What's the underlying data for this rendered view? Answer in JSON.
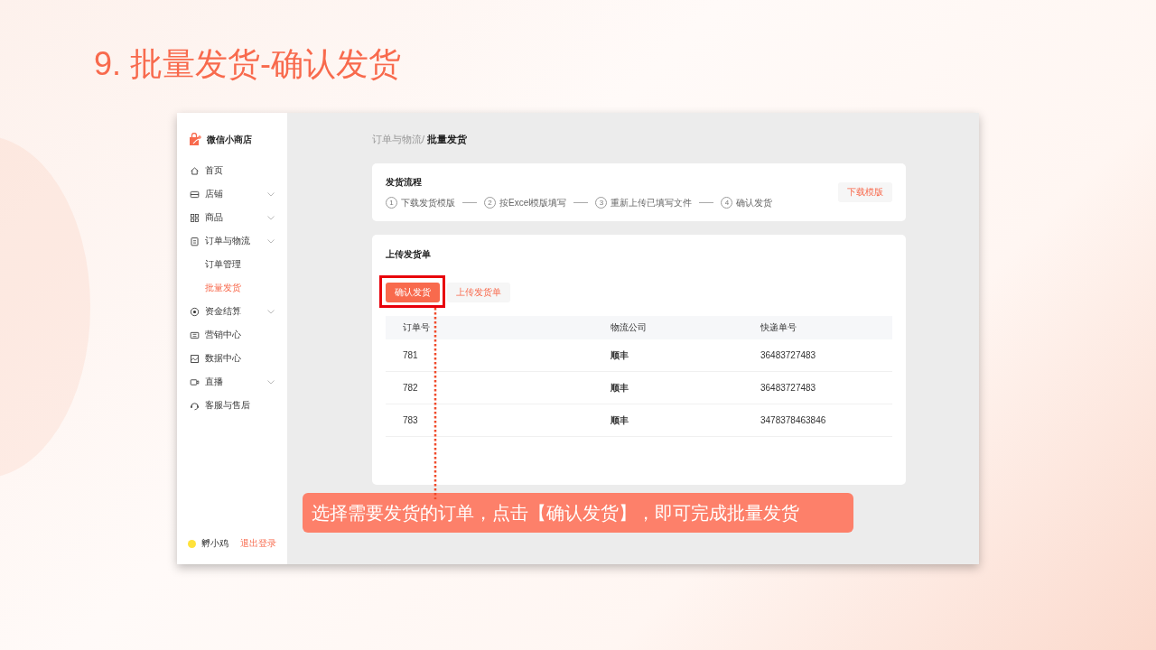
{
  "slide_title": "9. 批量发货-确认发货",
  "app": {
    "brand": "微信小商店",
    "sidebar": {
      "items": [
        {
          "label": "首页",
          "expandable": false
        },
        {
          "label": "店铺",
          "expandable": true
        },
        {
          "label": "商品",
          "expandable": true
        },
        {
          "label": "订单与物流",
          "expandable": true,
          "children": [
            {
              "label": "订单管理",
              "selected": false
            },
            {
              "label": "批量发货",
              "selected": true
            }
          ]
        },
        {
          "label": "资金结算",
          "expandable": true
        },
        {
          "label": "营销中心",
          "expandable": false
        },
        {
          "label": "数据中心",
          "expandable": false
        },
        {
          "label": "直播",
          "expandable": true
        },
        {
          "label": "客服与售后",
          "expandable": false
        }
      ],
      "user": "孵小鸡",
      "logout": "退出登录"
    },
    "breadcrumb": {
      "parent": "订单与物流/",
      "current": "批量发货"
    },
    "process_card": {
      "title": "发货流程",
      "steps": [
        {
          "number": "1",
          "label": "下载发货模版"
        },
        {
          "number": "2",
          "label": "按Excel模版填写"
        },
        {
          "number": "3",
          "label": "重新上传已填写文件"
        },
        {
          "number": "4",
          "label": "确认发货"
        }
      ],
      "button": "下载模版"
    },
    "upload_card": {
      "title": "上传发货单",
      "buttons": [
        {
          "label": "确认发货",
          "kind": "primary",
          "highlighted": true
        },
        {
          "label": "上传发货单",
          "kind": "secondary",
          "highlighted": false
        }
      ],
      "table": {
        "columns": [
          "订单号",
          "物流公司",
          "快递单号"
        ],
        "rows": [
          [
            "781",
            "顺丰",
            "36483727483"
          ],
          [
            "782",
            "顺丰",
            "36483727483"
          ],
          [
            "783",
            "顺丰",
            "3478378463846"
          ]
        ]
      }
    }
  },
  "callout": "选择需要发货的订单，点击【确认发货】，即可完成批量发货"
}
